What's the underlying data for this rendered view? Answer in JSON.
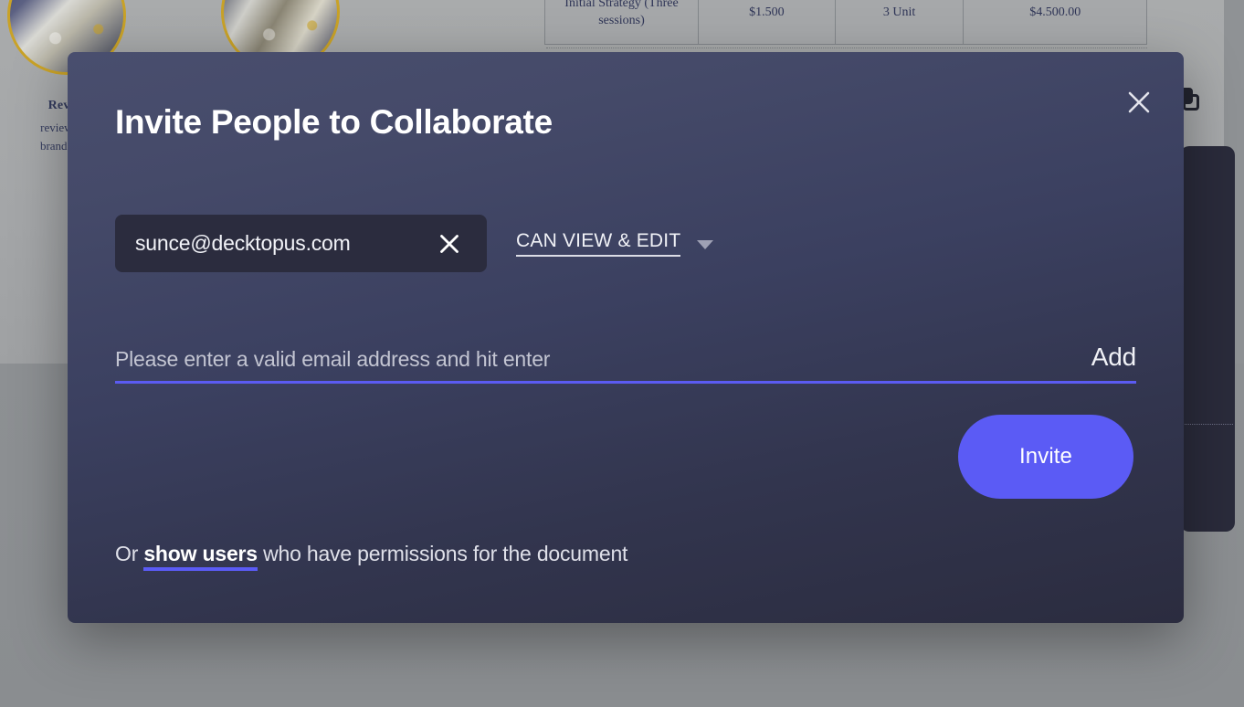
{
  "background": {
    "captions": {
      "title": "Review",
      "line1": "review sites",
      "line2": "brand to the"
    },
    "price_table": {
      "rows": [
        {
          "name": "Initial Strategy (Three sessions)",
          "unit_price": "$1.500",
          "quantity": "3 Unit",
          "total": "$4.500.00"
        }
      ]
    },
    "icons": {
      "duplicate": "copy-icon"
    }
  },
  "modal": {
    "title": "Invite People to Collaborate",
    "close_icon": "close-icon",
    "chip": {
      "email": "sunce@decktopus.com",
      "remove_icon": "close-icon"
    },
    "permission": {
      "selected": "CAN VIEW & EDIT",
      "caret_icon": "chevron-down-icon",
      "options": [
        "CAN VIEW & EDIT"
      ]
    },
    "email_input": {
      "value": "",
      "placeholder": "Please enter a valid email address and hit enter"
    },
    "add_label": "Add",
    "invite_label": "Invite",
    "footer": {
      "prefix": "Or ",
      "link": "show users",
      "suffix": " who have permissions for the document"
    },
    "colors": {
      "accent": "#5b5bf5",
      "chip_bg": "#2b2c3e",
      "modal_top": "#494e6e",
      "modal_bottom": "#2b2c3f"
    }
  }
}
